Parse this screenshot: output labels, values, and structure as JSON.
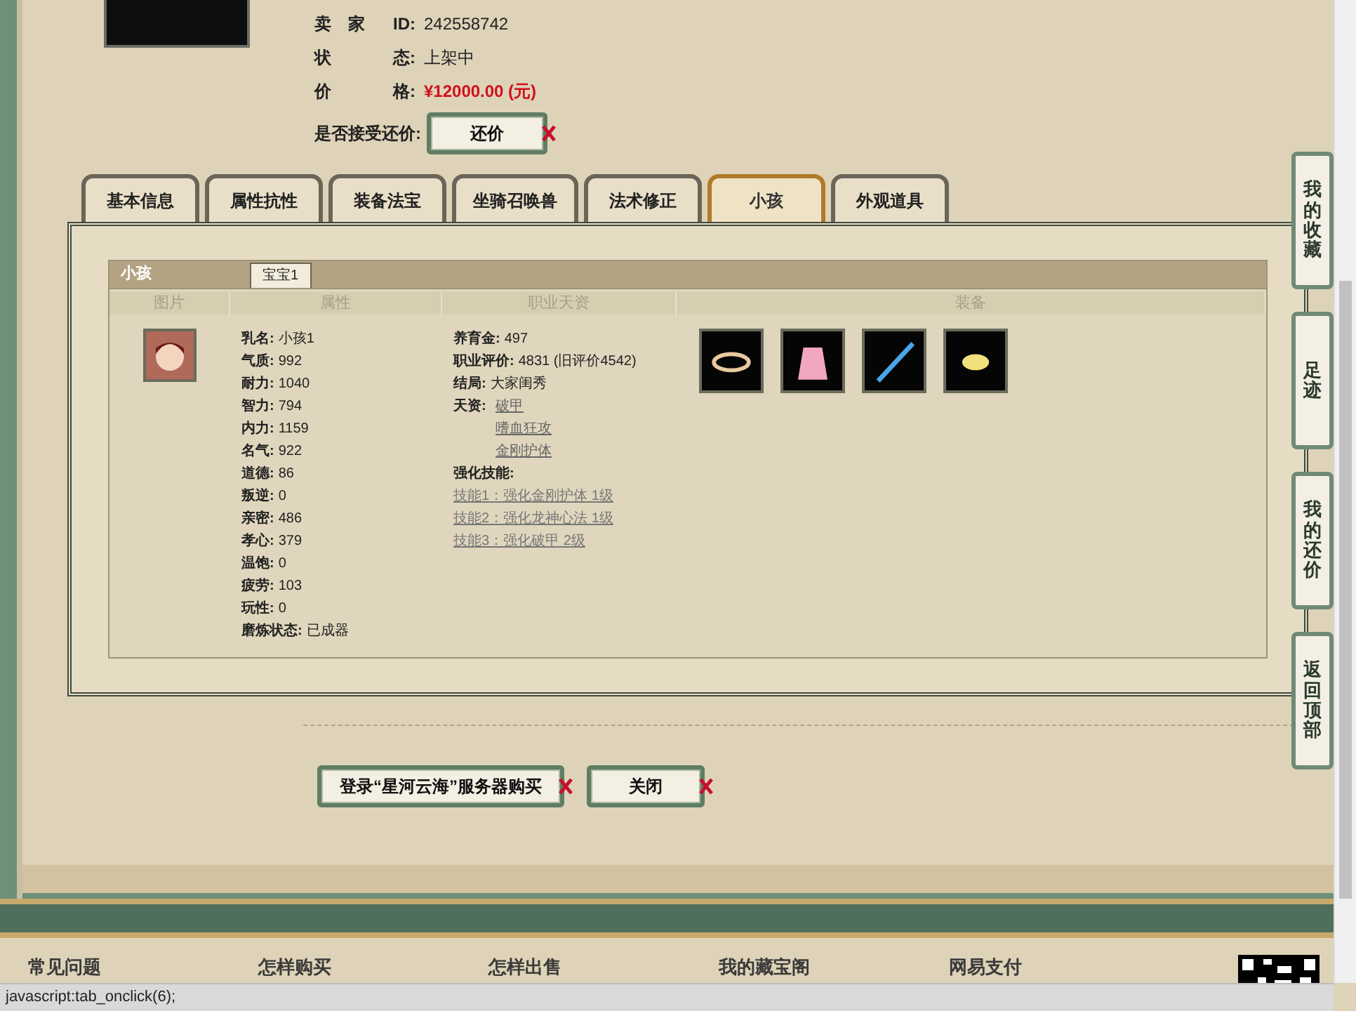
{
  "listing": {
    "seller_label": "卖　家",
    "id_label": "ID:",
    "seller_id": "242558742",
    "status_label": "状",
    "status_label_end": "态:",
    "status": "上架中",
    "price_label": "价",
    "price_label_end": "格:",
    "price": "¥12000.00 (元)",
    "bargain_label": "是否接受还价:",
    "bargain_button": "还价"
  },
  "tabs": [
    {
      "label": "基本信息",
      "selected": false
    },
    {
      "label": "属性抗性",
      "selected": false
    },
    {
      "label": "装备法宝",
      "selected": false
    },
    {
      "label": "坐骑召唤兽",
      "selected": false
    },
    {
      "label": "法术修正",
      "selected": false
    },
    {
      "label": "小孩",
      "selected": true
    },
    {
      "label": "外观道具",
      "selected": false
    }
  ],
  "child_panel": {
    "title": "小孩",
    "subtabs": [
      {
        "label": "宝宝1",
        "selected": true
      }
    ],
    "columns": [
      "图片",
      "属性",
      "职业天资",
      "装备"
    ],
    "attributes": [
      {
        "label": "乳名:",
        "value": "小孩1"
      },
      {
        "label": "气质:",
        "value": "992"
      },
      {
        "label": "耐力:",
        "value": "1040"
      },
      {
        "label": "智力:",
        "value": "794"
      },
      {
        "label": "内力:",
        "value": "1159"
      },
      {
        "label": "名气:",
        "value": "922"
      },
      {
        "label": "道德:",
        "value": "86"
      },
      {
        "label": "叛逆:",
        "value": "0"
      },
      {
        "label": "亲密:",
        "value": "486"
      },
      {
        "label": "孝心:",
        "value": "379"
      },
      {
        "label": "温饱:",
        "value": "0"
      },
      {
        "label": "疲劳:",
        "value": "103"
      },
      {
        "label": "玩性:",
        "value": "0"
      },
      {
        "label": "磨炼状态:",
        "value": "已成器"
      }
    ],
    "career": [
      {
        "label": "养育金:",
        "value": "497"
      },
      {
        "label": "职业评价:",
        "value": "4831 (旧评价4542)"
      },
      {
        "label": "结局:",
        "value": "大家闺秀"
      }
    ],
    "talent_label": "天资:",
    "talents": [
      "破甲",
      "嗜血狂攻",
      "金刚护体"
    ],
    "skills_label": "强化技能:",
    "skills": [
      "技能1：强化金刚护体 1级",
      "技能2：强化龙神心法 1级",
      "技能3：强化破甲 2级"
    ],
    "equipment": [
      {
        "kind": "ring"
      },
      {
        "kind": "dress"
      },
      {
        "kind": "sword"
      },
      {
        "kind": "shoes"
      }
    ]
  },
  "actions": [
    {
      "label": "登录“星河云海”服务器购买"
    },
    {
      "label": "关闭"
    }
  ],
  "side_nav": [
    {
      "label": "我的收藏"
    },
    {
      "label": "足迹"
    },
    {
      "label": "我的还价"
    },
    {
      "label": "返回顶部"
    }
  ],
  "footer": {
    "headings": [
      "常见问题",
      "怎样购买",
      "怎样出售",
      "我的藏宝阁",
      "网易支付"
    ]
  },
  "status_bar": "javascript:tab_onclick(6);"
}
